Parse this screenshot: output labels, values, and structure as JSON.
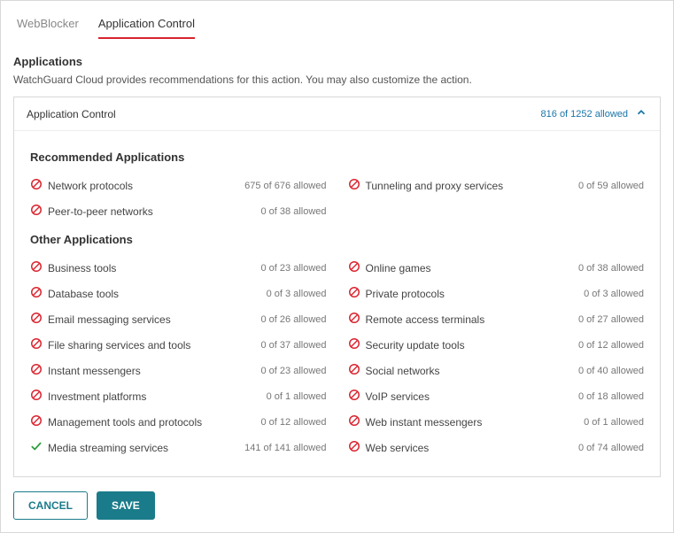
{
  "tabs": {
    "webblocker": "WebBlocker",
    "appcontrol": "Application Control"
  },
  "section": {
    "title": "Applications",
    "desc": "WatchGuard Cloud provides recommendations for this action. You may also customize the action."
  },
  "panel": {
    "title": "Application Control",
    "summary": "816 of 1252 allowed"
  },
  "groups": {
    "recommended_title": "Recommended Applications",
    "other_title": "Other Applications"
  },
  "recommended": [
    {
      "name": "Network protocols",
      "status": "675 of 676 allowed",
      "state": "block"
    },
    {
      "name": "Tunneling and proxy services",
      "status": "0 of 59 allowed",
      "state": "block"
    },
    {
      "name": "Peer-to-peer networks",
      "status": "0 of 38 allowed",
      "state": "block"
    }
  ],
  "other": [
    {
      "name": "Business tools",
      "status": "0 of 23 allowed",
      "state": "block"
    },
    {
      "name": "Online games",
      "status": "0 of 38 allowed",
      "state": "block"
    },
    {
      "name": "Database tools",
      "status": "0 of 3 allowed",
      "state": "block"
    },
    {
      "name": "Private protocols",
      "status": "0 of 3 allowed",
      "state": "block"
    },
    {
      "name": "Email messaging services",
      "status": "0 of 26 allowed",
      "state": "block"
    },
    {
      "name": "Remote access terminals",
      "status": "0 of 27 allowed",
      "state": "block"
    },
    {
      "name": "File sharing services and tools",
      "status": "0 of 37 allowed",
      "state": "block"
    },
    {
      "name": "Security update tools",
      "status": "0 of 12 allowed",
      "state": "block"
    },
    {
      "name": "Instant messengers",
      "status": "0 of 23 allowed",
      "state": "block"
    },
    {
      "name": "Social networks",
      "status": "0 of 40 allowed",
      "state": "block"
    },
    {
      "name": "Investment platforms",
      "status": "0 of 1 allowed",
      "state": "block"
    },
    {
      "name": "VoIP services",
      "status": "0 of 18 allowed",
      "state": "block"
    },
    {
      "name": "Management tools and protocols",
      "status": "0 of 12 allowed",
      "state": "block"
    },
    {
      "name": "Web instant messengers",
      "status": "0 of 1 allowed",
      "state": "block"
    },
    {
      "name": "Media streaming services",
      "status": "141 of 141 allowed",
      "state": "allow"
    },
    {
      "name": "Web services",
      "status": "0 of 74 allowed",
      "state": "block"
    }
  ],
  "buttons": {
    "cancel": "CANCEL",
    "save": "SAVE"
  }
}
